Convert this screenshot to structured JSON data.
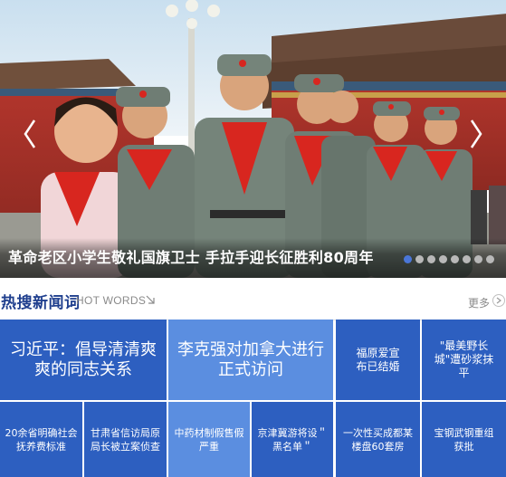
{
  "carousel": {
    "caption": "革命老区小学生敬礼国旗卫士 手拉手迎长征胜利80周年",
    "slide_count": 8,
    "active_slide": 1,
    "prev_label": "‹",
    "next_label": "›",
    "image_description_icon": "photo-children-red-scarves"
  },
  "hot": {
    "title": "热搜新闻词",
    "subtitle": "HOT WORDS",
    "more_label": "更多"
  },
  "tiles": [
    {
      "text": "习近平：倡导清清爽爽的同志关系"
    },
    {
      "text": "李克强对加拿大进行正式访问"
    },
    {
      "text": "福原爱宣布已结婚"
    },
    {
      "text": "\"最美野长城\"遭砂浆抹平"
    },
    {
      "text": "20余省明确社会抚养费标准"
    },
    {
      "text": "甘肃省信访局原局长被立案侦查"
    },
    {
      "text": "中药材制假售假严重"
    },
    {
      "text": "京津冀游将设＂黑名单＂"
    },
    {
      "text": "一次性买成都某楼盘60套房"
    },
    {
      "text": "宝钢武钢重组获批"
    }
  ],
  "colors": {
    "tile_dark": "#2d5fc0",
    "tile_light": "#5b8ee0",
    "title_blue": "#1f3f8e",
    "dot_active": "#4a76d8"
  }
}
